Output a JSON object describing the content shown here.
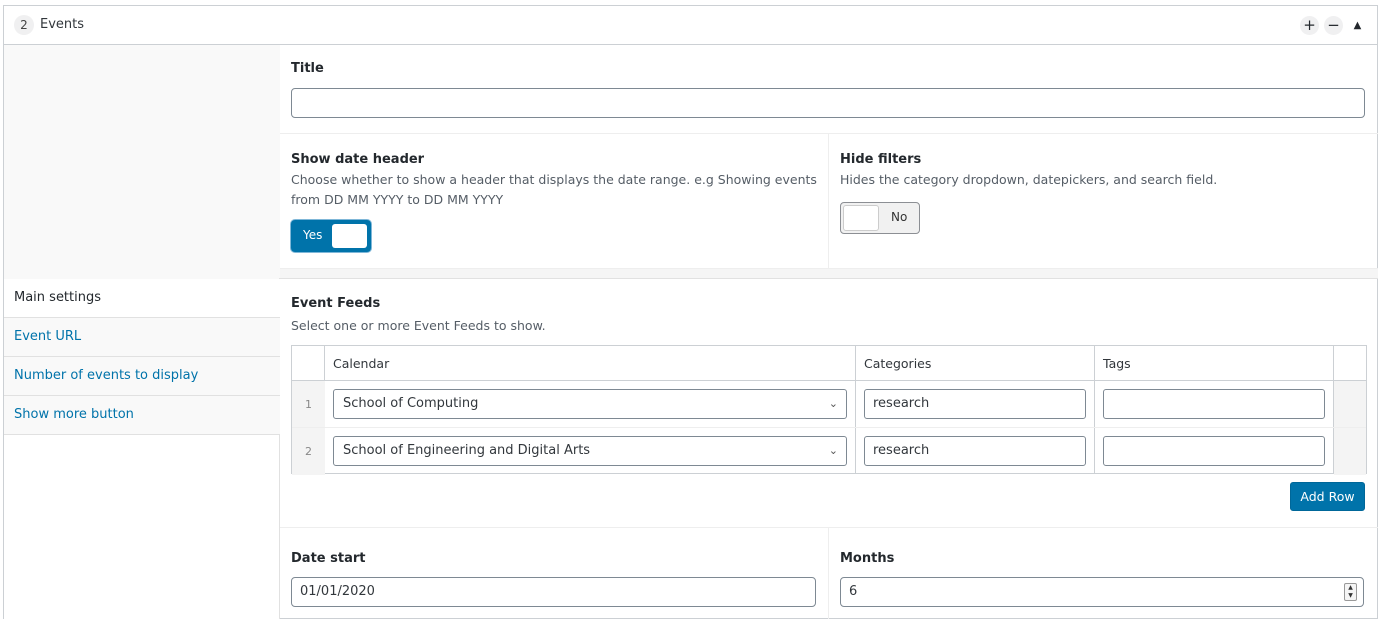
{
  "header": {
    "row_number": "2",
    "title": "Events",
    "add_icon": "plus-icon",
    "remove_icon": "minus-icon",
    "collapse_icon": "triangle-up-icon"
  },
  "sidebar": {
    "items": [
      {
        "label": "Main settings",
        "active": true
      },
      {
        "label": "Event URL",
        "active": false
      },
      {
        "label": "Number of events to display",
        "active": false
      },
      {
        "label": "Show more button",
        "active": false
      }
    ]
  },
  "title_field": {
    "label": "Title",
    "value": ""
  },
  "show_date_header": {
    "label": "Show date header",
    "description": "Choose whether to show a header that displays the date range. e.g Showing events from DD MM YYYY to DD MM YYYY",
    "state_label": "Yes",
    "enabled": true
  },
  "hide_filters": {
    "label": "Hide filters",
    "description": "Hides the category dropdown, datepickers, and search field.",
    "state_label": "No",
    "enabled": false
  },
  "event_feeds": {
    "label": "Event Feeds",
    "description": "Select one or more Event Feeds to show.",
    "columns": [
      "Calendar",
      "Categories",
      "Tags"
    ],
    "rows": [
      {
        "index": "1",
        "calendar": "School of Computing",
        "categories": "research",
        "tags": ""
      },
      {
        "index": "2",
        "calendar": "School of Engineering and Digital Arts",
        "categories": "research",
        "tags": ""
      }
    ],
    "add_row_label": "Add Row"
  },
  "date_start": {
    "label": "Date start",
    "value": "01/01/2020"
  },
  "months": {
    "label": "Months",
    "value": "6"
  },
  "colors": {
    "accent": "#0073aa",
    "link": "#0073aa",
    "border": "#ccd0d4"
  }
}
